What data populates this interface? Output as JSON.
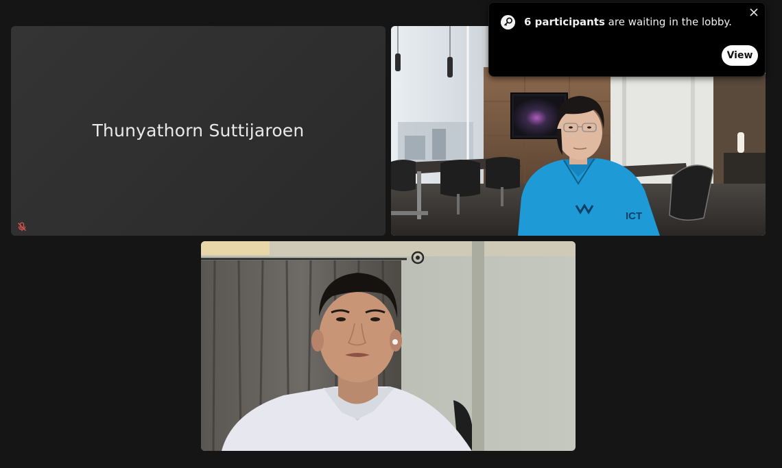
{
  "tiles": {
    "placeholder": {
      "participant_name": "Thunyathorn Suttijaroen",
      "mic_state_icon": "mic-off-icon"
    },
    "video_office": {
      "shirt_logo": "ICT"
    },
    "video_home": {}
  },
  "lobby_notification": {
    "icon": "key-icon",
    "count_text": "6 participants",
    "message_suffix": " are waiting in the lobby.",
    "view_label": "View",
    "close_icon": "close-icon"
  },
  "colors": {
    "background": "#151515",
    "tile_background": "#2d2d2d",
    "toast_background": "#000000",
    "mic_off": "#d9534f"
  }
}
